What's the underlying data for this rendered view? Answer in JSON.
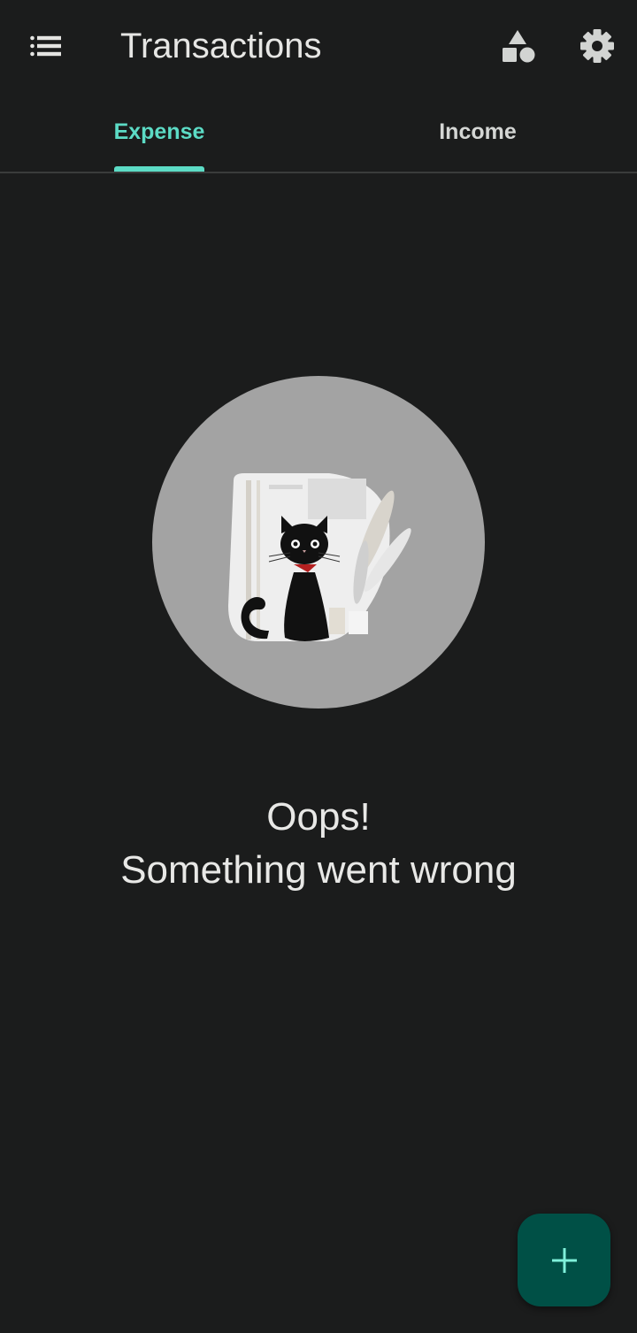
{
  "app_bar": {
    "title": "Transactions",
    "menu_icon": "list-icon",
    "categories_icon": "shapes-icon",
    "settings_icon": "gear-icon"
  },
  "tabs": [
    {
      "label": "Expense",
      "selected": true
    },
    {
      "label": "Income",
      "selected": false
    }
  ],
  "error": {
    "line1": "Oops!",
    "line2": "Something went wrong",
    "illustration": "black-cat-illustration"
  },
  "fab": {
    "icon": "plus-icon"
  },
  "colors": {
    "background": "#1b1c1c",
    "accent": "#5cdbc5",
    "fab_background": "#005046",
    "illustration_circle": "#a3a3a3"
  }
}
